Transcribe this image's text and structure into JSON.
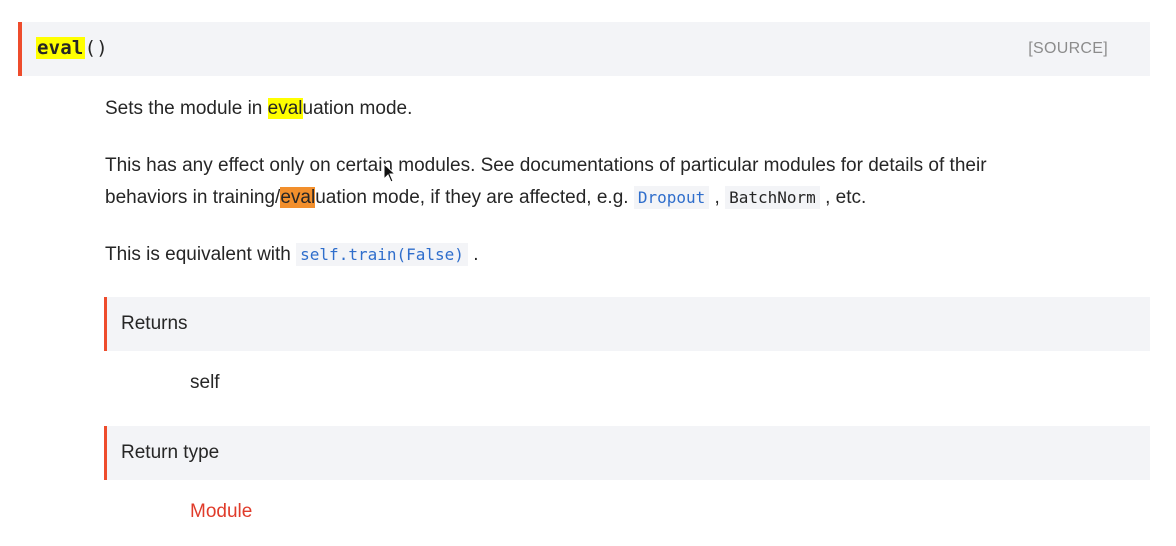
{
  "signature": {
    "name": "eval",
    "parens": "()",
    "source_label": "[SOURCE]"
  },
  "paragraphs": {
    "p1": {
      "pre": "Sets the module in ",
      "hl": "eval",
      "post": "uation mode."
    },
    "p2": {
      "line1": "This has any effect only on certain modules. See documentations of particular modules for details of their",
      "line2_pre": "behaviors in training/",
      "line2_hl": "eval",
      "line2_mid": "uation mode, if they are affected, e.g. ",
      "code1": "Dropout",
      "sep": " , ",
      "code2": "BatchNorm",
      "line2_post": " , etc."
    },
    "p3": {
      "pre": "This is equivalent with ",
      "code": "self.train(False)",
      "post": " ."
    }
  },
  "fields": {
    "returns_label": "Returns",
    "returns_value": "self",
    "return_type_label": "Return type",
    "return_type_value": "Module"
  },
  "colors": {
    "accent": "#ee4c2c",
    "highlight_yellow": "#ffff00",
    "highlight_orange": "#f28f2c",
    "link_blue": "#2f6ecc"
  }
}
